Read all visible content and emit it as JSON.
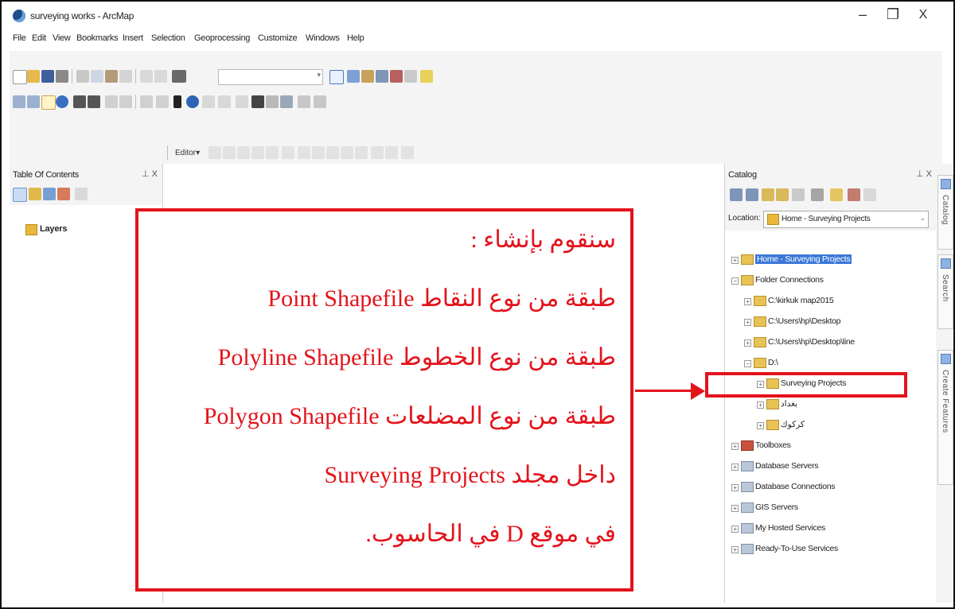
{
  "window": {
    "title": "surveying works - ArcMap",
    "minimize": "–",
    "maximize": "❐",
    "close": "X"
  },
  "menu": [
    "File",
    "Edit",
    "View",
    "Bookmarks",
    "Insert",
    "Selection",
    "Geoprocessing",
    "Customize",
    "Windows",
    "Help"
  ],
  "toolbars": {
    "editor_label": "Editor▾"
  },
  "toc": {
    "title": "Table Of Contents",
    "controls": "⊥ X",
    "layers_label": "Layers"
  },
  "annotation": {
    "lines": [
      "سنقوم بإنشاء :",
      "طبقة من نوع النقاط Point Shapefile",
      "طبقة من نوع الخطوط  Polyline Shapefile",
      "طبقة من نوع المضلعات  Polygon Shapefile",
      "داخل مجلد Surveying Projects",
      "في موقع D في الحاسوب."
    ]
  },
  "catalog": {
    "title": "Catalog",
    "controls": "⊥ X",
    "location_label": "Location:",
    "location_value": "Home - Surveying Projects",
    "tree": [
      {
        "label": "Home - Surveying Projects",
        "expander": "+",
        "selected": true
      },
      {
        "label": "Folder Connections",
        "expander": "−"
      },
      {
        "label": "C:\\kirkuk map2015",
        "expander": "+"
      },
      {
        "label": "C:\\Users\\hp\\Desktop",
        "expander": "+"
      },
      {
        "label": "C:\\Users\\hp\\Desktop\\line",
        "expander": "+"
      },
      {
        "label": "D:\\",
        "expander": "−"
      },
      {
        "label": "Surveying Projects",
        "expander": "+"
      },
      {
        "label": "بغداد",
        "expander": "+"
      },
      {
        "label": "كركوك",
        "expander": "+"
      },
      {
        "label": "Toolboxes",
        "expander": "+"
      },
      {
        "label": "Database Servers",
        "expander": "+"
      },
      {
        "label": "Database Connections",
        "expander": "+"
      },
      {
        "label": "GIS Servers",
        "expander": "+"
      },
      {
        "label": "My Hosted Services",
        "expander": "+"
      },
      {
        "label": "Ready-To-Use Services",
        "expander": "+"
      }
    ]
  },
  "side_tabs": [
    "Catalog",
    "Search",
    "Create Features"
  ],
  "colors": {
    "annotation_red": "#e3131b",
    "selection_blue": "#3b78d8"
  }
}
